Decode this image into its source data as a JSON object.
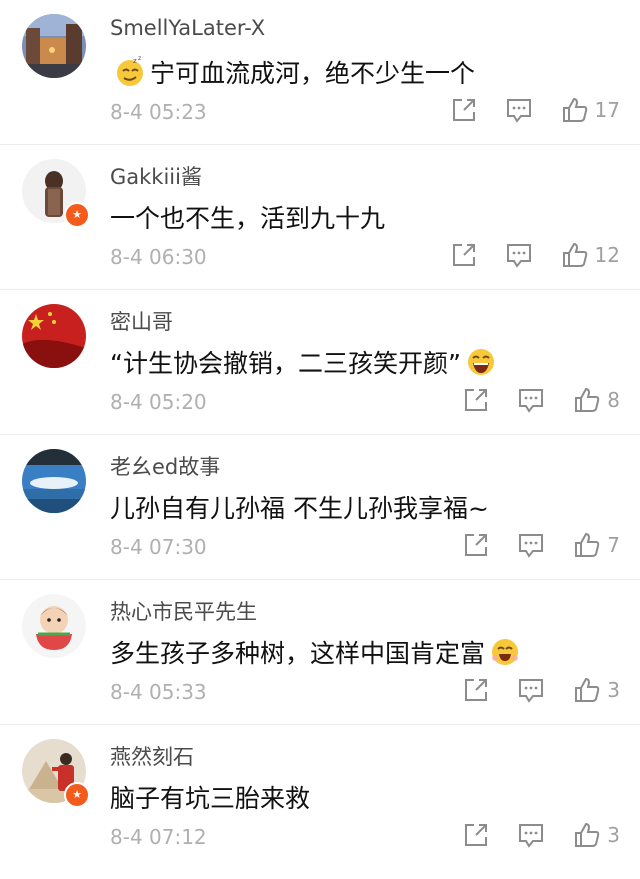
{
  "comments": [
    {
      "user": "SmellYaLater-X",
      "text": "宁可血流成河，绝不少生一个",
      "time": "8-4 05:23",
      "likes": "17",
      "badge": false,
      "emoji": "smirk",
      "emoji_pos": "before"
    },
    {
      "user": "Gakkiii酱",
      "text": "一个也不生，活到九十九",
      "time": "8-4 06:30",
      "likes": "12",
      "badge": true,
      "emoji": "",
      "emoji_pos": ""
    },
    {
      "user": "密山哥",
      "text": "“计生协会撤销，二三孩笑开颜”",
      "time": "8-4 05:20",
      "likes": "8",
      "badge": false,
      "emoji": "laugh",
      "emoji_pos": "after"
    },
    {
      "user": "老幺ed故事",
      "text": "儿孙自有儿孙福  不生儿孙我享福~",
      "time": "8-4 07:30",
      "likes": "7",
      "badge": false,
      "emoji": "",
      "emoji_pos": ""
    },
    {
      "user": "热心市民平先生",
      "text": "多生孩子多种树，这样中国肯定富",
      "time": "8-4 05:33",
      "likes": "3",
      "badge": false,
      "emoji": "grin",
      "emoji_pos": "after"
    },
    {
      "user": "燕然刻石",
      "text": "脑子有坑三胎来救",
      "time": "8-4 07:12",
      "likes": "3",
      "badge": true,
      "emoji": "",
      "emoji_pos": ""
    }
  ],
  "icons": {
    "share": "share-icon",
    "reply": "comment-icon",
    "like": "thumbs-up-icon"
  },
  "colors": {
    "badge": "#f25b1b",
    "time": "#b0b0b0",
    "divider": "#ececec"
  }
}
